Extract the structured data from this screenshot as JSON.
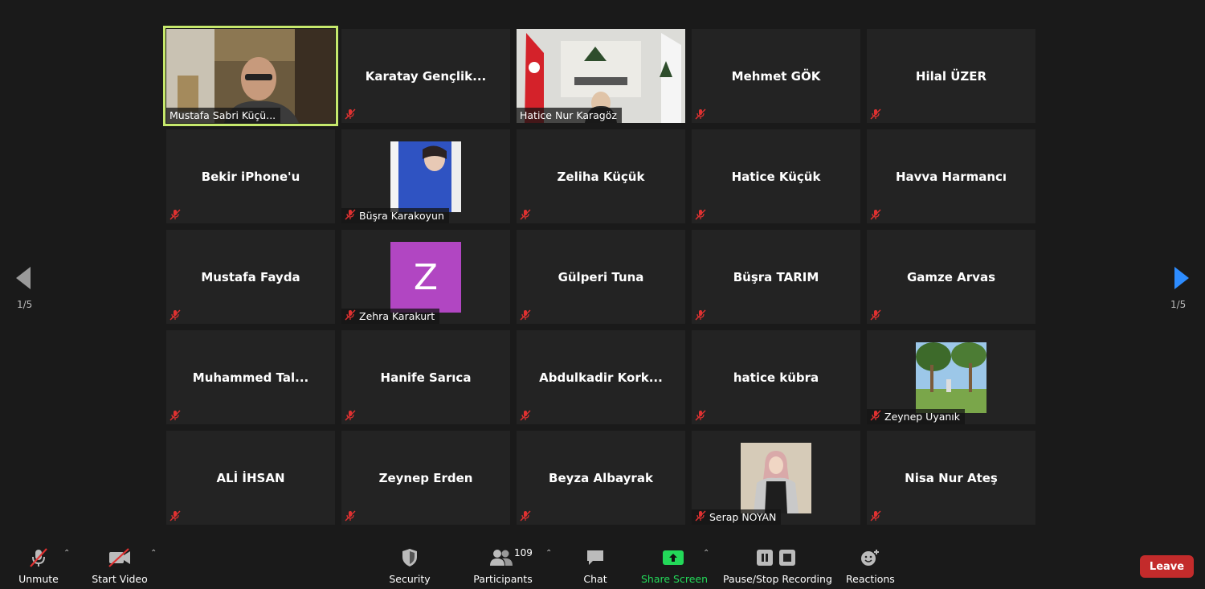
{
  "tiles": [
    {
      "name": "Mustafa Sabri Küçü...",
      "style": "video-man",
      "active": true
    },
    {
      "name": "Karatay  Gençlik...",
      "style": "center"
    },
    {
      "name": "Hatice Nur Karagöz",
      "style": "video-karatay"
    },
    {
      "name": "Mehmet GÖK",
      "style": "center"
    },
    {
      "name": "Hilal ÜZER",
      "style": "center"
    },
    {
      "name": "Bekir iPhone'u",
      "style": "center"
    },
    {
      "name": "Büşra Karakoyun",
      "style": "photo-blue"
    },
    {
      "name": "Zeliha Küçük",
      "style": "center"
    },
    {
      "name": "Hatice Küçük",
      "style": "center"
    },
    {
      "name": "Havva Harmancı",
      "style": "center"
    },
    {
      "name": "Mustafa Fayda",
      "style": "center"
    },
    {
      "name": "Zehra Karakurt",
      "style": "avatar",
      "initial": "Z"
    },
    {
      "name": "Gülperi Tuna",
      "style": "center"
    },
    {
      "name": "Büşra TARIM",
      "style": "center"
    },
    {
      "name": "Gamze Arvas",
      "style": "center"
    },
    {
      "name": "Muhammed  Tal...",
      "style": "center"
    },
    {
      "name": "Hanife Sarıca",
      "style": "center"
    },
    {
      "name": "Abdulkadir  Kork...",
      "style": "center"
    },
    {
      "name": "hatice kübra",
      "style": "center"
    },
    {
      "name": "Zeynep Uyanık",
      "style": "photo-trees"
    },
    {
      "name": "ALİ İHSAN",
      "style": "center"
    },
    {
      "name": "Zeynep Erden",
      "style": "center"
    },
    {
      "name": "Beyza Albayrak",
      "style": "center"
    },
    {
      "name": "Serap NOYAN",
      "style": "photo-woman"
    },
    {
      "name": "Nisa Nur Ateş",
      "style": "center"
    }
  ],
  "pagination": {
    "left": "1/5",
    "right": "1/5"
  },
  "toolbar": {
    "unmute": "Unmute",
    "start_video": "Start Video",
    "security": "Security",
    "participants": "Participants",
    "participants_count": "109",
    "chat": "Chat",
    "share_screen": "Share Screen",
    "recording": "Pause/Stop Recording",
    "reactions": "Reactions",
    "leave": "Leave"
  },
  "colors": {
    "active_outline": "#c6e86c",
    "share_green": "#23d959",
    "leave_red": "#c32b2b",
    "avatar_purple": "#b146c2",
    "arrow_blue": "#2d8cff"
  }
}
